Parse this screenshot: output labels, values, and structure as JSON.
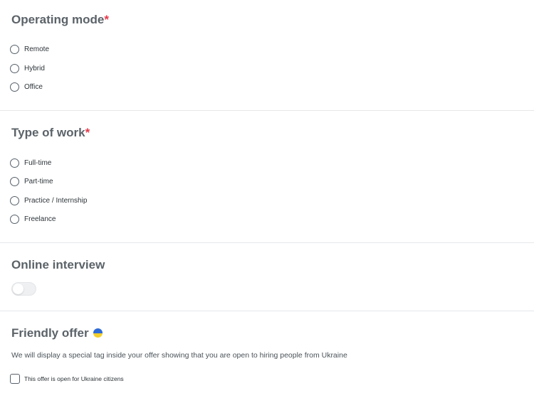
{
  "operating_mode": {
    "title": "Operating mode",
    "required_mark": "*",
    "options": [
      "Remote",
      "Hybrid",
      "Office"
    ],
    "selected": null
  },
  "type_of_work": {
    "title": "Type of work",
    "required_mark": "*",
    "options": [
      "Full-time",
      "Part-time",
      "Practice / Internship",
      "Freelance"
    ],
    "selected": null
  },
  "online_interview": {
    "title": "Online interview",
    "enabled": false
  },
  "friendly_offer": {
    "title": "Friendly offer",
    "flag_icon": "ukraine-flag-icon",
    "description": "We will display a special tag inside your offer showing that you are open to hiring people from Ukraine",
    "checkbox_label": "This offer is open for Ukraine citizens",
    "checked": false
  },
  "colors": {
    "required": "#e5394a",
    "heading": "#5b6369",
    "divider": "#e4e7ea",
    "flag_blue": "#2f6bd6",
    "flag_yellow": "#f4cf2b"
  }
}
